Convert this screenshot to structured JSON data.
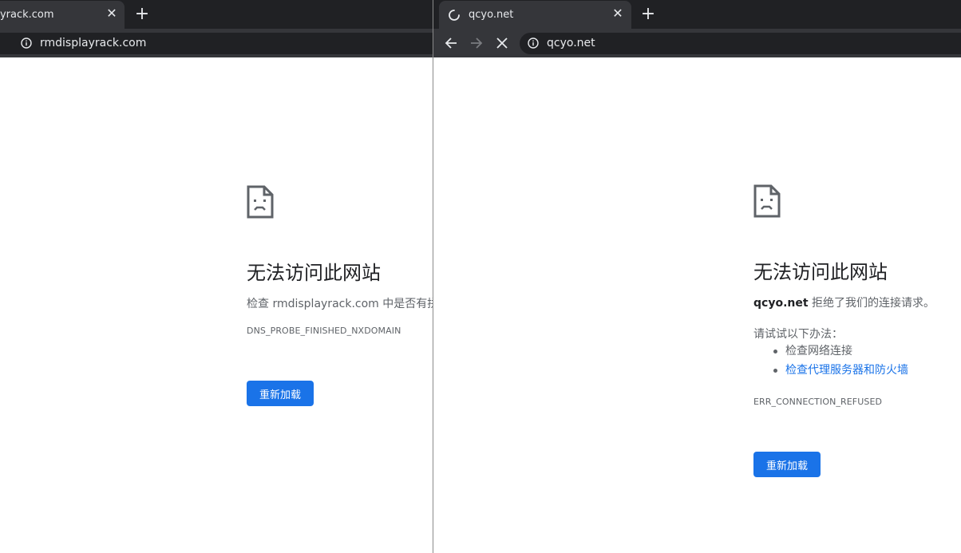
{
  "left_window": {
    "tab_title": "ayrack.com",
    "url": "rmdisplayrack.com",
    "error_heading": "无法访问此网站",
    "error_description": "检查 rmdisplayrack.com 中是否有拼",
    "error_code": "DNS_PROBE_FINISHED_NXDOMAIN",
    "reload_label": "重新加载"
  },
  "right_window": {
    "tab_title": "qcyo.net",
    "url": "qcyo.net",
    "error_heading": "无法访问此网站",
    "error_host": "qcyo.net",
    "error_message": " 拒绝了我们的连接请求。",
    "suggestions_title": "请试试以下办法：",
    "suggestions": [
      "检查网络连接",
      "检查代理服务器和防火墙"
    ],
    "error_code": "ERR_CONNECTION_REFUSED",
    "reload_label": "重新加载"
  },
  "colors": {
    "tabstrip_bg": "#202124",
    "toolbar_bg": "#35363a",
    "accent": "#1a73e8",
    "text": "#202124",
    "secondary_text": "#5f6368"
  },
  "icons": [
    "close-icon",
    "new-tab-icon",
    "back-arrow-icon",
    "forward-arrow-icon",
    "stop-loading-icon",
    "info-icon",
    "sad-page-icon",
    "loading-spinner-icon"
  ]
}
